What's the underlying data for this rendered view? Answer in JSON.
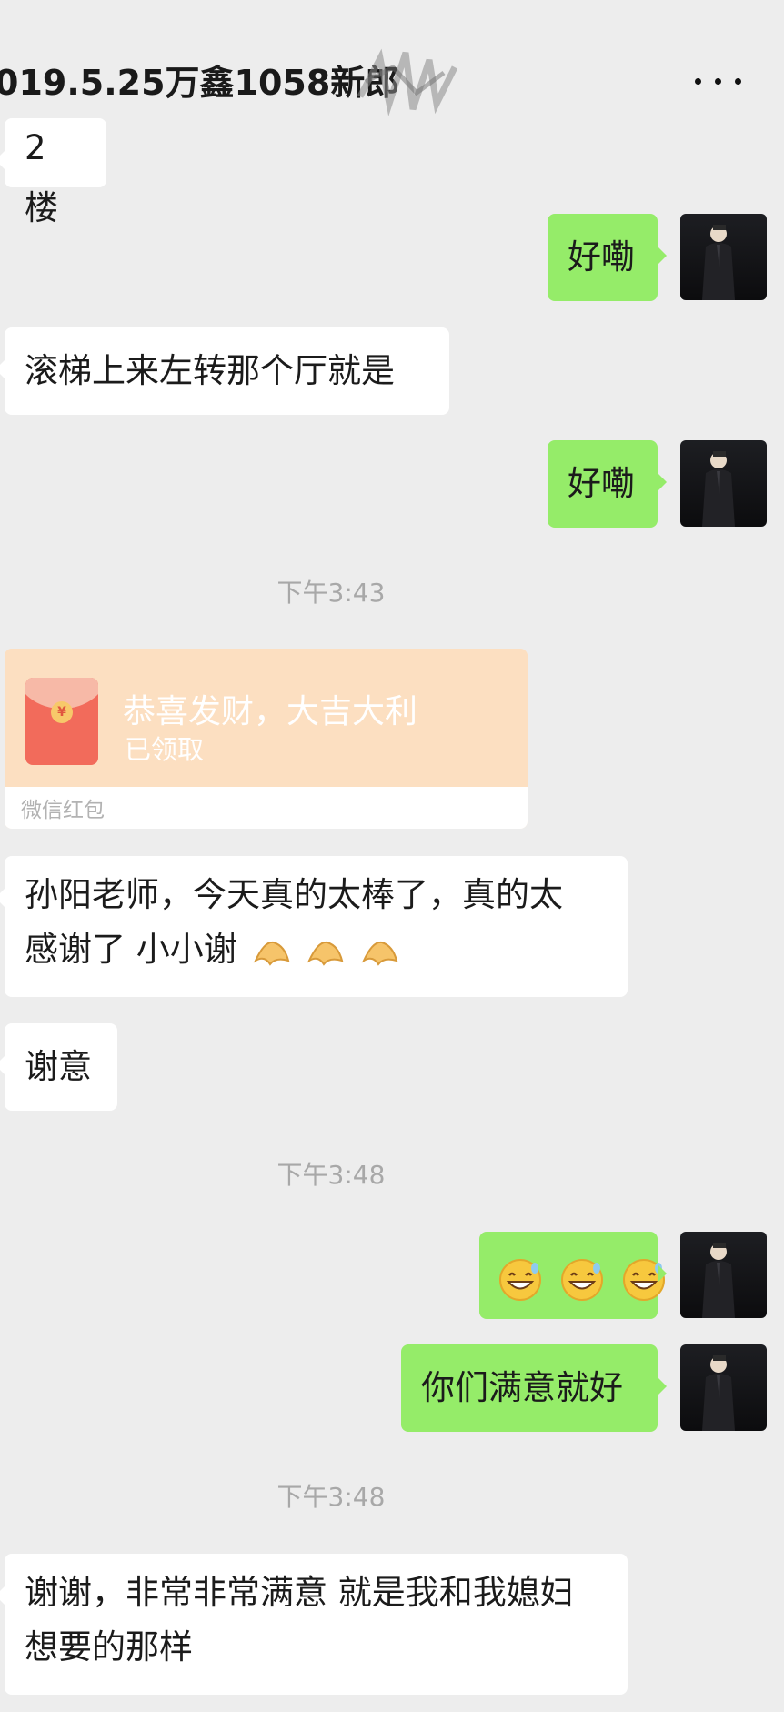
{
  "status_bar": {
    "left_text": "",
    "right_text": ""
  },
  "header": {
    "title": "019.5.25万鑫1058新郎",
    "more_icon": "more-icon"
  },
  "messages": [
    {
      "side": "in",
      "text": "2 楼"
    },
    {
      "side": "out",
      "text": "好嘞"
    },
    {
      "side": "in",
      "text": "滚梯上来左转那个厅就是"
    },
    {
      "side": "out",
      "text": "好嘞"
    },
    {
      "time": "下午3:43"
    },
    {
      "type": "red_packet",
      "side": "in",
      "greeting": "恭喜发财，大吉大利",
      "status": "已领取",
      "label": "微信红包"
    },
    {
      "side": "in",
      "line1": "孙阳老师，今天真的太棒了，真的太",
      "line2": "感谢了  小小谢"
    },
    {
      "side": "in",
      "text": "谢意"
    },
    {
      "time": "下午3:48"
    },
    {
      "side": "out",
      "emoji": "grinning-sweat-emoji"
    },
    {
      "side": "out",
      "text": "你们满意就好"
    },
    {
      "time": "下午3:48"
    },
    {
      "side": "in",
      "line1": "谢谢，非常非常满意 就是我和我媳妇",
      "line2": "想要的那样"
    }
  ],
  "colors": {
    "background": "#ededed",
    "incoming_bubble": "#ffffff",
    "outgoing_bubble": "#95ec69",
    "red_packet": "#fcdfc1",
    "timestamp": "#a8a8a8"
  }
}
